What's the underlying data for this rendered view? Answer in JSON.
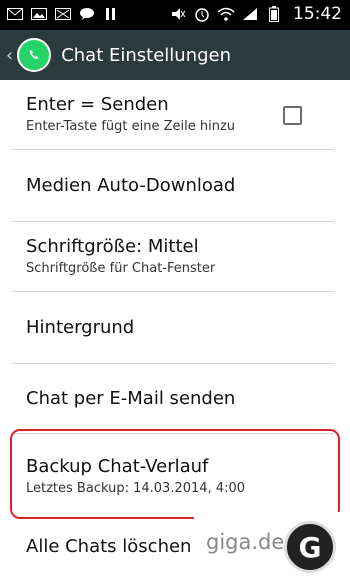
{
  "status_bar": {
    "time": "15:42",
    "icons_left": [
      "mail-icon",
      "image-icon",
      "missed-call-icon",
      "chat-bubble-icon",
      "pause-icon"
    ],
    "icons_right": [
      "mute-icon",
      "alarm-icon",
      "wifi-icon",
      "signal-icon",
      "battery-icon"
    ]
  },
  "header": {
    "title": "Chat Einstellungen",
    "back_glyph": "‹"
  },
  "settings": [
    {
      "title": "Enter = Senden",
      "subtitle": "Enter-Taste fügt eine Zeile hinzu",
      "checked": false
    },
    {
      "title": "Medien Auto-Download"
    },
    {
      "title": "Schriftgröße: Mittel",
      "subtitle": "Schriftgröße für Chat-Fenster"
    },
    {
      "title": "Hintergrund"
    },
    {
      "title": "Chat per E-Mail senden"
    },
    {
      "title": "Backup Chat-Verlauf",
      "subtitle": "Letztes Backup: 14.03.2014, 4:00"
    },
    {
      "title": "Alle Chats löschen"
    }
  ],
  "watermark": {
    "text": "giga.de",
    "logo_letter": "G"
  },
  "colors": {
    "action_bar": "#2b3a3d",
    "highlight": "#d9232b",
    "whatsapp_green": "#25d366"
  }
}
